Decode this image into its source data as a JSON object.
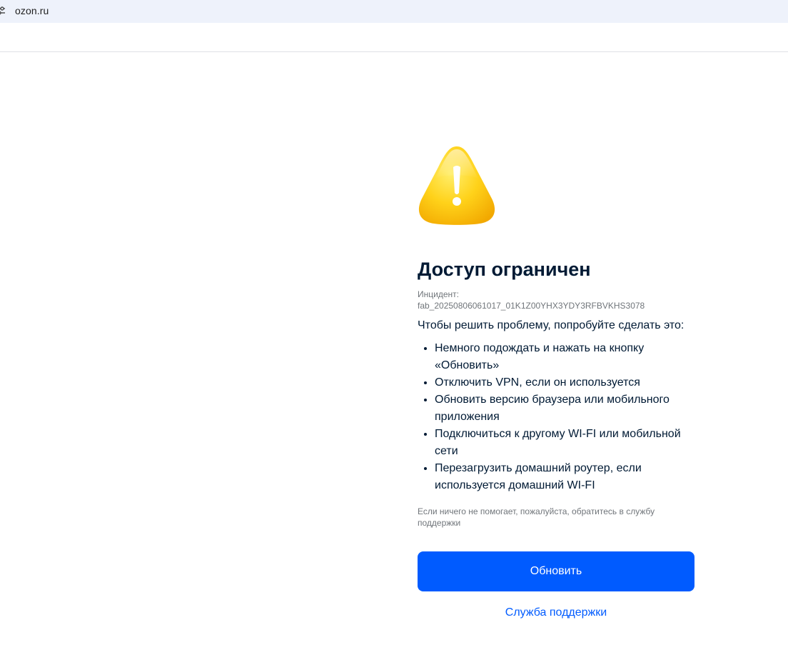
{
  "browser": {
    "url": "ozon.ru",
    "site_icon": "tune-icon"
  },
  "error_page": {
    "icon": "warning-icon",
    "title": "Доступ ограничен",
    "incident_label": "Инцидент:",
    "incident_id": "fab_20250806061017_01K1Z00YHX3YDY3RFBVKHS3078",
    "intro": "Чтобы решить проблему, попробуйте сделать это:",
    "tips": [
      "Немного подождать и нажать на кнопку «Обновить»",
      "Отключить VPN, если он используется",
      "Обновить версию браузера или мобильного приложения",
      "Подключиться к другому WI-FI или мобильной сети",
      "Перезагрузить домашний роутер, если используется домашний WI-FI"
    ],
    "help_text": "Если ничего не помогает, пожалуйста, обратитесь в службу поддержки",
    "refresh_button": "Обновить",
    "support_link": "Служба поддержки"
  },
  "colors": {
    "accent": "#005bff",
    "title_text": "#001a34",
    "muted_text": "#70757a",
    "warning_yellow": "#ffc800"
  }
}
